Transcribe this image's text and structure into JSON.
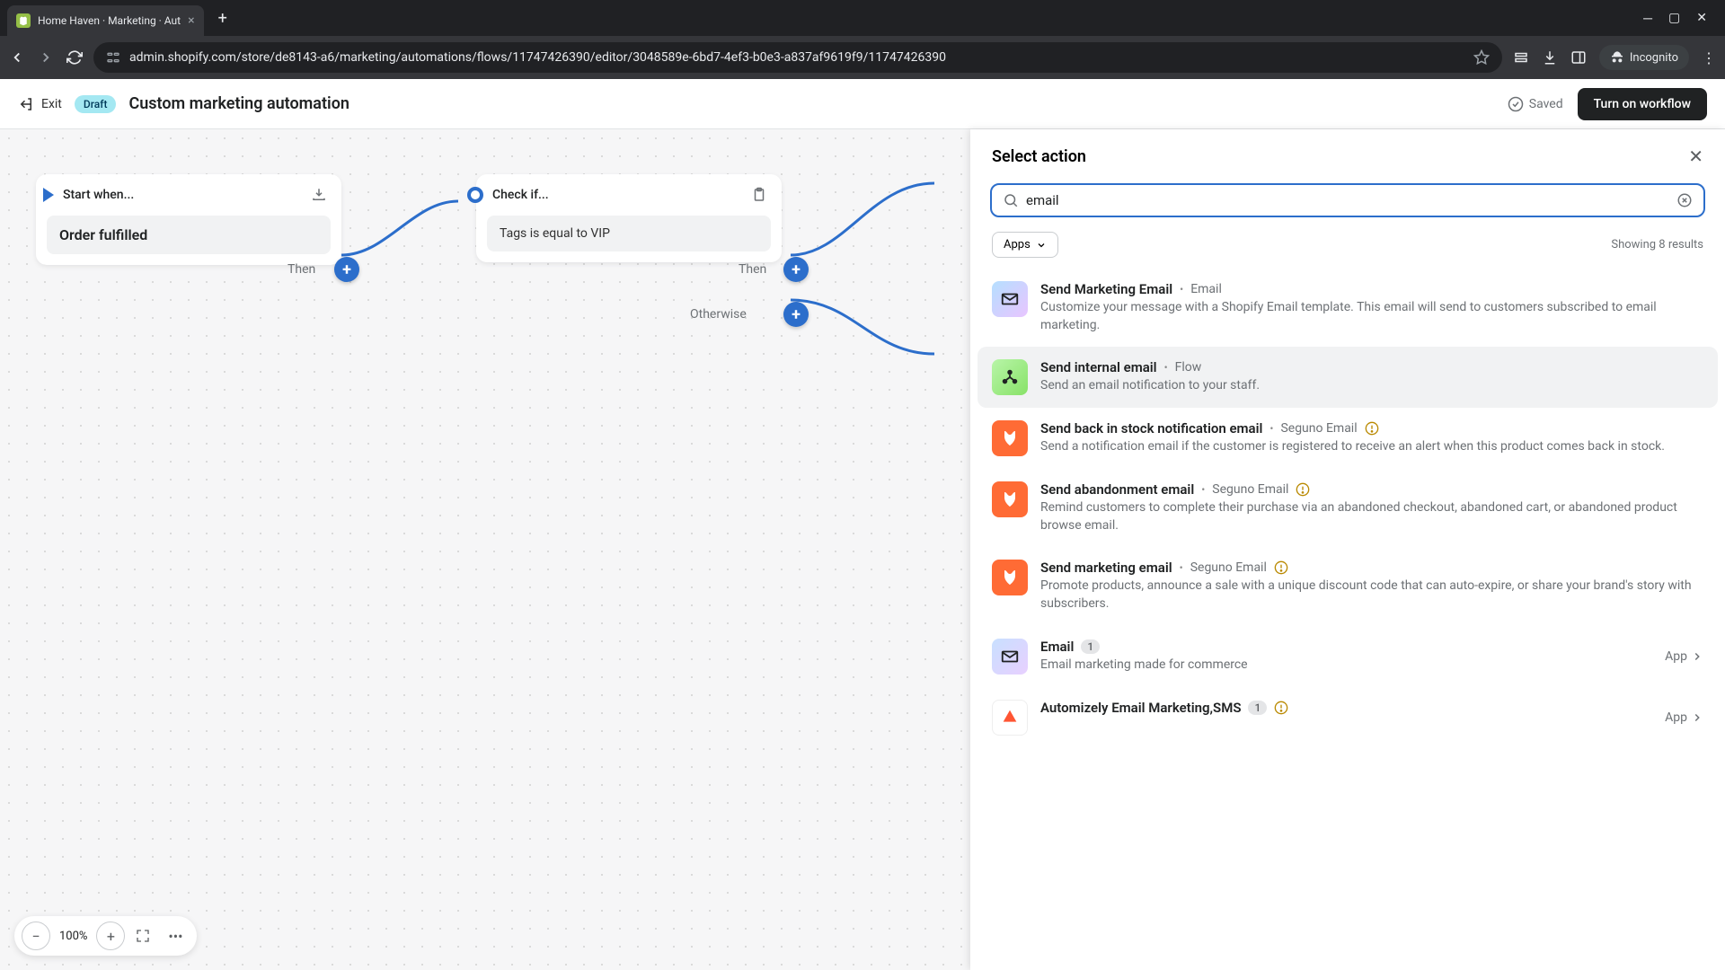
{
  "browser": {
    "tab_title": "Home Haven · Marketing · Aut",
    "url": "admin.shopify.com/store/de8143-a6/marketing/automations/flows/11747426390/editor/3048589e-6bd7-4ef3-b0e3-a837af9619f9/11747426390",
    "incognito_label": "Incognito"
  },
  "header": {
    "exit_label": "Exit",
    "draft_badge": "Draft",
    "page_title": "Custom marketing automation",
    "saved_label": "Saved",
    "turn_on_label": "Turn on workflow"
  },
  "canvas": {
    "start_node": {
      "title": "Start when...",
      "body": "Order fulfilled"
    },
    "check_node": {
      "title": "Check if...",
      "body": "Tags is equal to VIP"
    },
    "then_label": "Then",
    "otherwise_label": "Otherwise",
    "zoom": "100%"
  },
  "panel": {
    "title": "Select action",
    "search_value": "email",
    "apps_filter": "Apps",
    "result_count": "Showing 8 results",
    "actions": [
      {
        "title": "Send Marketing Email",
        "source": "Email",
        "desc": "Customize your message with a Shopify Email template. This email will send to customers subscribed to email marketing.",
        "icon": "email",
        "warn": false
      },
      {
        "title": "Send internal email",
        "source": "Flow",
        "desc": "Send an email notification to your staff.",
        "icon": "flow",
        "warn": false,
        "hovered": true
      },
      {
        "title": "Send back in stock notification email",
        "source": "Seguno Email",
        "desc": "Send a notification email if the customer is registered to receive an alert when this product comes back in stock.",
        "icon": "seguno",
        "warn": true
      },
      {
        "title": "Send abandonment email",
        "source": "Seguno Email",
        "desc": "Remind customers to complete their purchase via an abandoned checkout, abandoned cart, or abandoned product browse email.",
        "icon": "seguno",
        "warn": true
      },
      {
        "title": "Send marketing email",
        "source": "Seguno Email",
        "desc": "Promote products, announce a sale with a unique discount code that can auto-expire, or share your brand's story with subscribers.",
        "icon": "seguno",
        "warn": true
      },
      {
        "title": "Email",
        "source": "",
        "desc": "Email marketing made for commerce",
        "icon": "app-email",
        "badge": "1",
        "is_app": true,
        "app_label": "App"
      },
      {
        "title": "Automizely Email Marketing,SMS",
        "source": "",
        "desc": "",
        "icon": "automizely",
        "badge": "1",
        "warn": true,
        "is_app": true,
        "app_label": "App"
      }
    ]
  }
}
